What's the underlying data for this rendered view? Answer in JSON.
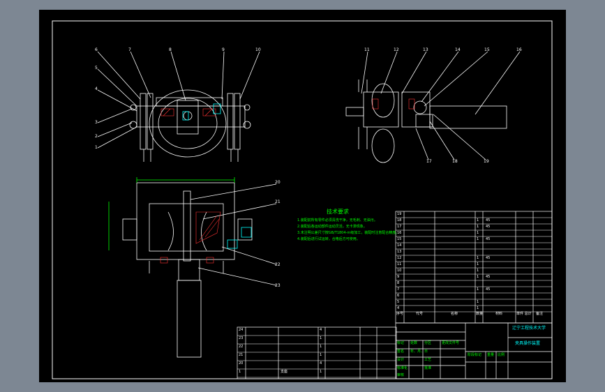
{
  "callouts": {
    "top_view": [
      "6",
      "7",
      "8",
      "9",
      "10",
      "5",
      "4",
      "3",
      "2",
      "1"
    ],
    "side_view": [
      "11",
      "12",
      "13",
      "14",
      "15",
      "16",
      "17",
      "18",
      "19"
    ],
    "front_view": [
      "20",
      "21",
      "22",
      "23"
    ]
  },
  "tech_req": {
    "title": "技术要求",
    "lines": [
      "1.装配前所有零件必须清洗干净，无毛刺、无油污。",
      "2.装配后各运动部件运动灵活，无卡滞现象。",
      "3.未注明公差尺寸按GB/T1804-m级加工，装配时注意配合精度。",
      "4.装配后进行试运转，合格后方可使用。"
    ]
  },
  "bom_upper": {
    "rows": [
      {
        "no": "19",
        "code": "",
        "name": "",
        "qty": "",
        "mat": ""
      },
      {
        "no": "18",
        "code": "",
        "name": "",
        "qty": "1",
        "mat": "45"
      },
      {
        "no": "17",
        "code": "",
        "name": "",
        "qty": "1",
        "mat": "45"
      },
      {
        "no": "16",
        "code": "",
        "name": "",
        "qty": "1",
        "mat": ""
      },
      {
        "no": "15",
        "code": "",
        "name": "",
        "qty": "1",
        "mat": "45"
      },
      {
        "no": "14",
        "code": "",
        "name": "",
        "qty": "",
        "mat": ""
      },
      {
        "no": "13",
        "code": "",
        "name": "",
        "qty": "",
        "mat": ""
      },
      {
        "no": "12",
        "code": "",
        "name": "",
        "qty": "1",
        "mat": "45"
      },
      {
        "no": "11",
        "code": "",
        "name": "",
        "qty": "1",
        "mat": ""
      },
      {
        "no": "10",
        "code": "",
        "name": "",
        "qty": "1",
        "mat": ""
      },
      {
        "no": "9",
        "code": "",
        "name": "",
        "qty": "1",
        "mat": "45"
      },
      {
        "no": "8",
        "code": "",
        "name": "",
        "qty": "",
        "mat": ""
      },
      {
        "no": "7",
        "code": "",
        "name": "",
        "qty": "1",
        "mat": "45"
      },
      {
        "no": "6",
        "code": "",
        "name": "",
        "qty": "",
        "mat": ""
      },
      {
        "no": "5",
        "code": "",
        "name": "",
        "qty": "1",
        "mat": ""
      },
      {
        "no": "4",
        "code": "",
        "name": "",
        "qty": "1",
        "mat": ""
      }
    ],
    "header": {
      "seq": "序号",
      "code": "代号",
      "name": "名称",
      "qty": "数量",
      "mat": "材料",
      "wt": "单件 总计",
      "remark": "备注"
    }
  },
  "bom_lower": {
    "rows": [
      {
        "no": "24",
        "code": "",
        "name": "",
        "qty": "4",
        "mat": ""
      },
      {
        "no": "23",
        "code": "",
        "name": "",
        "qty": "1",
        "mat": ""
      },
      {
        "no": "22",
        "code": "",
        "name": "",
        "qty": "1",
        "mat": ""
      },
      {
        "no": "21",
        "code": "",
        "name": "",
        "qty": "1",
        "mat": ""
      },
      {
        "no": "20",
        "code": "",
        "name": "",
        "qty": "4",
        "mat": ""
      },
      {
        "no": "1",
        "code": "",
        "name": "支座",
        "qty": "1",
        "mat": ""
      }
    ]
  },
  "title_block": {
    "school": "辽宁工程技术大学",
    "drawing_name": "夹具操作装置",
    "drawing_no": "",
    "labels": [
      "标记",
      "处数",
      "分区",
      "更改文件号",
      "签名",
      "年、月、日",
      "设计",
      "标准化",
      "审核",
      "工艺",
      "批准",
      "阶段标记",
      "重量",
      "比例"
    ]
  },
  "colors": {
    "background_outer": "#7d8793",
    "sheet": "#000000",
    "line": "#ffffff",
    "hatch": "#ff3333",
    "text_green": "#00ff00",
    "accent_cyan": "#00ffff"
  }
}
